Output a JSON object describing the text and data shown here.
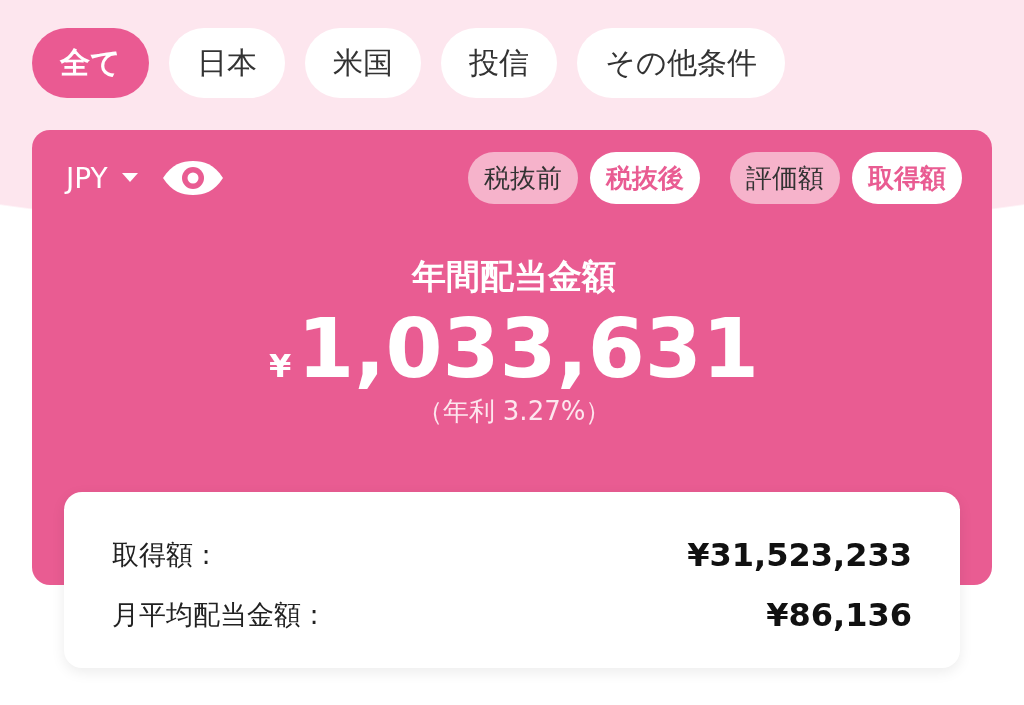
{
  "filters": [
    {
      "label": "全て",
      "selected": true
    },
    {
      "label": "日本",
      "selected": false
    },
    {
      "label": "米国",
      "selected": false
    },
    {
      "label": "投信",
      "selected": false
    },
    {
      "label": "その他条件",
      "selected": false
    }
  ],
  "dividend_card": {
    "currency": "JPY",
    "tax_toggle": [
      {
        "label": "税抜前",
        "selected": false
      },
      {
        "label": "税抜後",
        "selected": true
      }
    ],
    "basis_toggle": [
      {
        "label": "評価額",
        "selected": false
      },
      {
        "label": "取得額",
        "selected": true
      }
    ],
    "title": "年間配当金額",
    "currency_symbol": "¥",
    "amount": "1,033,631",
    "yield": "（年利 3.27%）"
  },
  "summary": [
    {
      "label": "取得額 :",
      "value": "¥31,523,233"
    },
    {
      "label": "月平均配当金額 :",
      "value": "¥86,136"
    }
  ]
}
